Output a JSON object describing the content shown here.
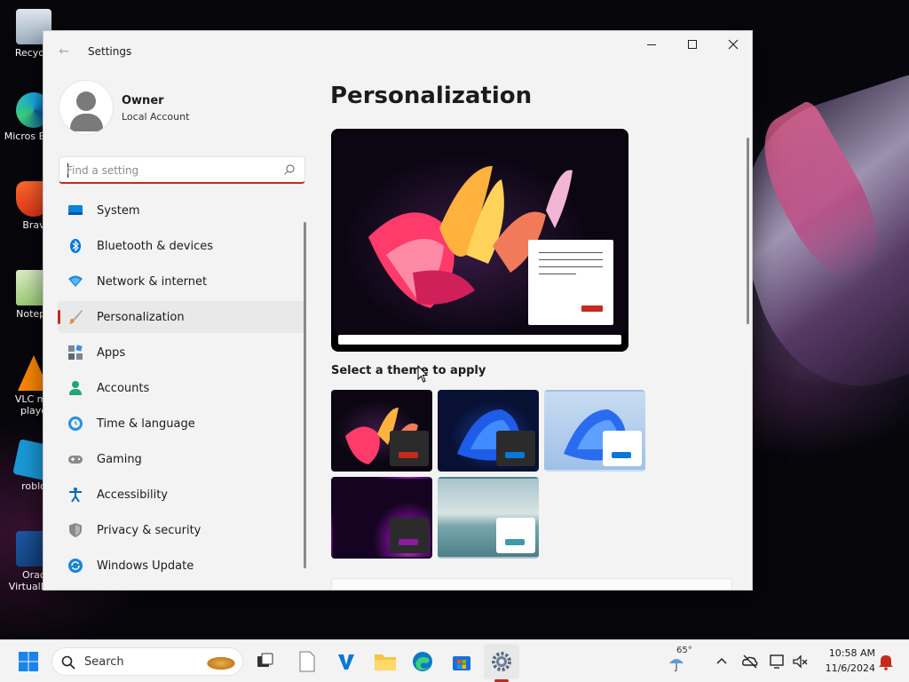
{
  "desktop": {
    "icons": [
      {
        "label": "Recycle",
        "icon": "recycle-bin-icon"
      },
      {
        "label": "Micros Edge",
        "icon": "edge-icon"
      },
      {
        "label": "Brav",
        "icon": "brave-icon"
      },
      {
        "label": "Notepa",
        "icon": "notepad-icon"
      },
      {
        "label": "VLC me playe",
        "icon": "vlc-icon"
      },
      {
        "label": "roblo",
        "icon": "roblox-icon"
      },
      {
        "label": "Orac VirtualBox",
        "icon": "virtualbox-icon"
      }
    ]
  },
  "window": {
    "title": "Settings",
    "back_icon": "arrow-left-icon"
  },
  "profile": {
    "name": "Owner",
    "account_type": "Local Account"
  },
  "search": {
    "placeholder": "Find a setting",
    "value": ""
  },
  "nav": {
    "items": [
      {
        "label": "System",
        "icon": "system-icon",
        "color": "#0067c0"
      },
      {
        "label": "Bluetooth & devices",
        "icon": "bluetooth-icon",
        "color": "#0078d4"
      },
      {
        "label": "Network & internet",
        "icon": "wifi-icon",
        "color": "#0a84d8"
      },
      {
        "label": "Personalization",
        "icon": "paintbrush-icon",
        "color": "#c8702a"
      },
      {
        "label": "Apps",
        "icon": "apps-icon",
        "color": "#5b6a7a"
      },
      {
        "label": "Accounts",
        "icon": "accounts-icon",
        "color": "#1fa67a"
      },
      {
        "label": "Time & language",
        "icon": "globe-clock-icon",
        "color": "#0a78d4"
      },
      {
        "label": "Gaming",
        "icon": "gamepad-icon",
        "color": "#6f6f6f"
      },
      {
        "label": "Accessibility",
        "icon": "accessibility-icon",
        "color": "#0067c0"
      },
      {
        "label": "Privacy & security",
        "icon": "shield-icon",
        "color": "#6b6b6b"
      },
      {
        "label": "Windows Update",
        "icon": "update-icon",
        "color": "#0a78d4"
      }
    ],
    "active_index": 3
  },
  "main": {
    "title": "Personalization",
    "theme_section_label": "Select a theme to apply",
    "themes": [
      {
        "name": "theme-glow-red",
        "accent": "#c42b1c"
      },
      {
        "name": "theme-bloom-dark",
        "accent": "#0a78d4"
      },
      {
        "name": "theme-bloom-light",
        "accent": "#0a78d4"
      },
      {
        "name": "theme-captured-motion",
        "accent": "#8b1aa0"
      },
      {
        "name": "theme-sunrise-flow",
        "accent": "#3d9aa8"
      }
    ]
  },
  "taskbar": {
    "search_label": "Search",
    "weather_temp": "65°",
    "time": "10:58 AM",
    "date": "11/6/2024"
  },
  "colors": {
    "accent": "#c42b1c"
  }
}
